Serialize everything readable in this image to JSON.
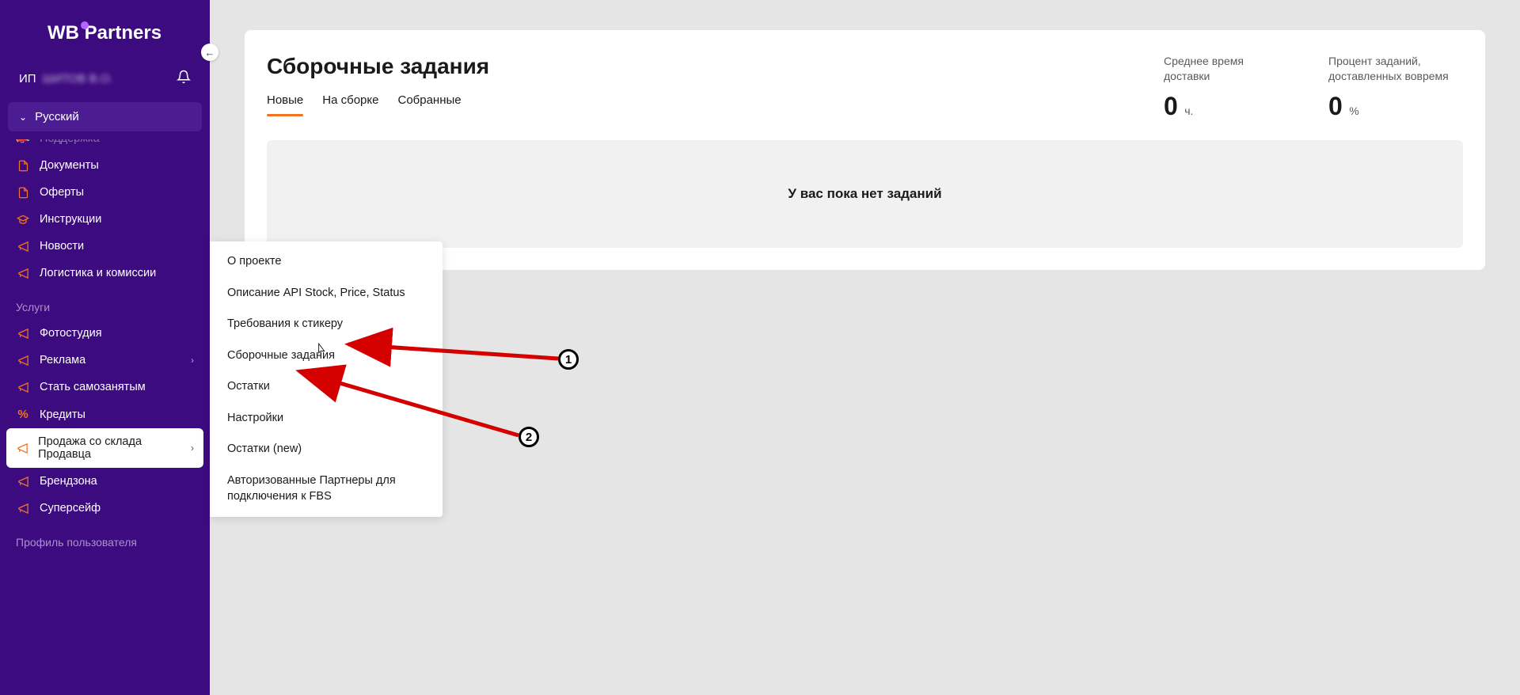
{
  "logo": {
    "text": "WB  Partners"
  },
  "user": {
    "prefix": "ИП",
    "blurred": "ШИТОВ В.О."
  },
  "language": {
    "label": "Русский"
  },
  "sidebar": {
    "truncated_top": "Поддержка",
    "items": [
      {
        "label": "Документы"
      },
      {
        "label": "Оферты"
      },
      {
        "label": "Инструкции"
      },
      {
        "label": "Новости"
      },
      {
        "label": "Логистика и комиссии"
      }
    ],
    "section_label": "Услуги",
    "service_items": [
      {
        "label": "Фотостудия"
      },
      {
        "label": "Реклама",
        "expandable": true
      },
      {
        "label": "Стать самозанятым"
      },
      {
        "label": "Кредиты"
      },
      {
        "label": "Продажа со склада Продавца",
        "active": true,
        "expandable": true
      },
      {
        "label": "Брендзона"
      },
      {
        "label": "Суперсейф"
      }
    ],
    "footer_label": "Профиль пользователя"
  },
  "submenu": {
    "items": [
      "О проекте",
      "Описание API Stock, Price, Status",
      "Требования к стикеру",
      "Сборочные задания",
      "Остатки",
      "Настройки",
      "Остатки (new)",
      "Авторизованные Партнеры для подключения к FBS"
    ]
  },
  "main": {
    "title": "Сборочные задания",
    "tabs": [
      {
        "label": "Новые",
        "active": true
      },
      {
        "label": "На сборке"
      },
      {
        "label": "Собранные"
      }
    ],
    "stats": [
      {
        "label": "Среднее время доставки",
        "value": "0",
        "unit": "ч."
      },
      {
        "label": "Процент заданий, доставленных вовремя",
        "value": "0",
        "unit": "%"
      }
    ],
    "empty_text": "У вас пока нет заданий"
  },
  "annotations": {
    "badge1": "1",
    "badge2": "2"
  }
}
